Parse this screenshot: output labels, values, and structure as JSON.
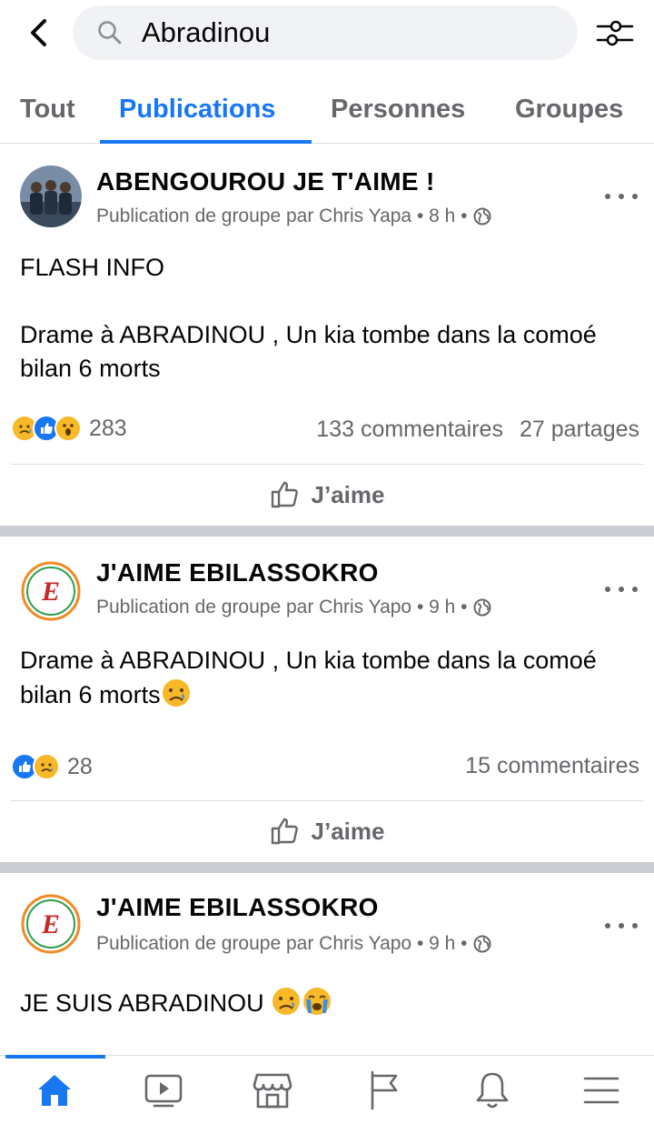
{
  "search": {
    "query": "Abradinou"
  },
  "tabs": [
    {
      "label": "Tout"
    },
    {
      "label": "Publications"
    },
    {
      "label": "Personnes"
    },
    {
      "label": "Groupes"
    }
  ],
  "posts": [
    {
      "group": "ABENGOUROU JE T'AIME !",
      "meta": "Publication de groupe par Chris Yapa • 8 h •",
      "text_line1": "FLASH INFO",
      "text_line2": "Drame à ABRADINOU  , Un kia tombe dans la comoé bilan 6 morts",
      "reactions_count": "283",
      "comments": "133 commentaires",
      "shares": "27 partages",
      "like_label": "J’aime"
    },
    {
      "group": "J'AIME EBILASSOKRO",
      "meta": "Publication de groupe par Chris Yapo • 9 h •",
      "text_line1": "Drame à ABRADINOU  , Un kia tombe dans la comoé bilan 6 morts",
      "reactions_count": "28",
      "comments": "15 commentaires",
      "like_label": "J’aime"
    },
    {
      "group": "J'AIME EBILASSOKRO",
      "meta": "Publication de groupe par Chris Yapo • 9 h •",
      "text_line1": "JE SUIS ABRADINOU "
    }
  ],
  "colors": {
    "accent": "#1877f2",
    "muted": "#65676b",
    "separator": "#c9ccd1"
  },
  "icons": [
    "back-arrow-icon",
    "search-icon",
    "filter-icon",
    "globe-icon",
    "more-icon",
    "like-thumb-icon",
    "home-icon",
    "video-icon",
    "marketplace-icon",
    "pages-flag-icon",
    "bell-icon",
    "menu-icon"
  ]
}
